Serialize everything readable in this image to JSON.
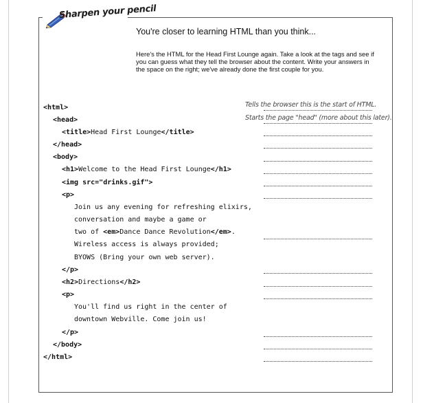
{
  "header": {
    "section_title": "Sharpen your pencil",
    "icon": "pencil-icon"
  },
  "intro": {
    "heading": "You're closer to learning HTML than you think...",
    "body": "Here's the HTML for the Head First Lounge again. Take a look at the tags and see if you can guess what they tell the browser about the content. Write your answers in the space on the right; we've already done the first couple for you."
  },
  "code_lines": [
    {
      "pre": "",
      "tag": "<html>",
      "mid": "",
      "tag2": "",
      "post": ""
    },
    {
      "pre": "",
      "tag": "<head>",
      "mid": "",
      "tag2": "",
      "post": ""
    },
    {
      "pre": "",
      "tag": "<title>",
      "mid": "Head First Lounge",
      "tag2": "</title>",
      "post": ""
    },
    {
      "pre": "",
      "tag": "</head>",
      "mid": "",
      "tag2": "",
      "post": ""
    },
    {
      "pre": "",
      "tag": "<body>",
      "mid": "",
      "tag2": "",
      "post": ""
    },
    {
      "pre": "",
      "tag": "<h1>",
      "mid": "Welcome to the Head First Lounge",
      "tag2": "</h1>",
      "post": ""
    },
    {
      "pre": "",
      "tag": "<img src=\"drinks.gif\">",
      "mid": "",
      "tag2": "",
      "post": ""
    },
    {
      "pre": "",
      "tag": "<p>",
      "mid": "",
      "tag2": "",
      "post": ""
    },
    {
      "pre": "Join us any evening for refreshing elixirs,",
      "tag": "",
      "mid": "",
      "tag2": "",
      "post": ""
    },
    {
      "pre": "conversation and maybe a game or",
      "tag": "",
      "mid": "",
      "tag2": "",
      "post": ""
    },
    {
      "pre": "two of ",
      "tag": "<em>",
      "mid": "Dance Dance Revolution",
      "tag2": "</em>",
      "post": "."
    },
    {
      "pre": "Wireless access is always provided;",
      "tag": "",
      "mid": "",
      "tag2": "",
      "post": ""
    },
    {
      "pre": "BYOWS (Bring your own web server).",
      "tag": "",
      "mid": "",
      "tag2": "",
      "post": ""
    },
    {
      "pre": "",
      "tag": "</p>",
      "mid": "",
      "tag2": "",
      "post": ""
    },
    {
      "pre": "",
      "tag": "<h2>",
      "mid": "Directions",
      "tag2": "</h2>",
      "post": ""
    },
    {
      "pre": "",
      "tag": "<p>",
      "mid": "",
      "tag2": "",
      "post": ""
    },
    {
      "pre": "You'll find us right in the center of",
      "tag": "",
      "mid": "",
      "tag2": "",
      "post": ""
    },
    {
      "pre": "downtown Webville. Come join us!",
      "tag": "",
      "mid": "",
      "tag2": "",
      "post": ""
    },
    {
      "pre": "",
      "tag": "</p>",
      "mid": "",
      "tag2": "",
      "post": ""
    },
    {
      "pre": "",
      "tag": "</body>",
      "mid": "",
      "tag2": "",
      "post": ""
    },
    {
      "pre": "",
      "tag": "</html>",
      "mid": "",
      "tag2": "",
      "post": ""
    }
  ],
  "answers": {
    "html": "Tells the browser this is the start of HTML.",
    "head": "Starts the page \"head\" (more about this later)."
  }
}
